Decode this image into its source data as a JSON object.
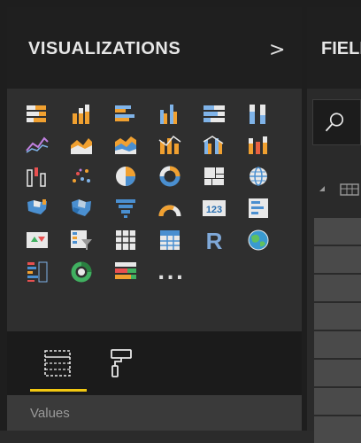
{
  "visualizations": {
    "title": "VISUALIZATIONS",
    "collapse_glyph": ">",
    "icons": [
      {
        "name": "stacked-bar-chart-icon"
      },
      {
        "name": "stacked-column-chart-icon"
      },
      {
        "name": "clustered-bar-chart-icon"
      },
      {
        "name": "clustered-column-chart-icon"
      },
      {
        "name": "100-stacked-bar-chart-icon"
      },
      {
        "name": "100-stacked-column-chart-icon"
      },
      {
        "name": "line-chart-icon"
      },
      {
        "name": "area-chart-icon"
      },
      {
        "name": "stacked-area-chart-icon"
      },
      {
        "name": "line-and-stacked-column-chart-icon"
      },
      {
        "name": "line-and-clustered-column-chart-icon"
      },
      {
        "name": "ribbon-chart-icon"
      },
      {
        "name": "waterfall-chart-icon"
      },
      {
        "name": "scatter-chart-icon"
      },
      {
        "name": "pie-chart-icon"
      },
      {
        "name": "donut-chart-icon"
      },
      {
        "name": "treemap-icon"
      },
      {
        "name": "map-icon"
      },
      {
        "name": "filled-map-icon"
      },
      {
        "name": "shape-map-icon"
      },
      {
        "name": "funnel-icon"
      },
      {
        "name": "gauge-icon"
      },
      {
        "name": "card-icon"
      },
      {
        "name": "multi-row-card-icon"
      },
      {
        "name": "kpi-icon"
      },
      {
        "name": "slicer-icon"
      },
      {
        "name": "table-icon"
      },
      {
        "name": "matrix-icon"
      },
      {
        "name": "r-script-visual-icon"
      },
      {
        "name": "arcgis-map-icon"
      },
      {
        "name": "custom-visual-list-icon"
      },
      {
        "name": "custom-visual-donut-icon"
      },
      {
        "name": "custom-visual-bars-icon"
      }
    ],
    "more_label": "...",
    "card_value": "123",
    "r_label": "R"
  },
  "tabs": [
    {
      "name": "fields-tab",
      "icon": "fields-grid-icon",
      "selected": true
    },
    {
      "name": "format-tab",
      "icon": "paint-roller-icon",
      "selected": false
    }
  ],
  "values_section": {
    "label": "Values"
  },
  "fields": {
    "title": "FIELDS",
    "search_icon": "search-icon",
    "field_count": 8
  },
  "colors": {
    "accent": "#f2c811",
    "panel": "#2f2f2f",
    "header": "#1f1f1f"
  }
}
